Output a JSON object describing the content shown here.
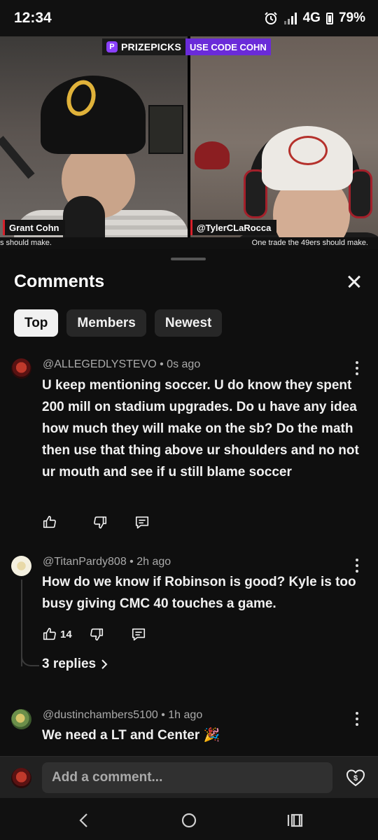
{
  "status_bar": {
    "time": "12:34",
    "network": "4G",
    "battery": "79%",
    "icons": [
      "alarm-icon",
      "signal-icon",
      "battery-icon"
    ]
  },
  "video": {
    "promo_brand": "PRIZEPICKS",
    "promo_code": "USE CODE COHN",
    "left_name": "Grant Cohn",
    "right_name": "@TylerCLaRocca",
    "ticker_left": "s should make.",
    "ticker_right": "One trade the 49ers should make."
  },
  "comments_sheet": {
    "title": "Comments",
    "filters": [
      "Top",
      "Members",
      "Newest"
    ],
    "active_filter": "Top"
  },
  "comments": [
    {
      "author": "@ALLEGEDLYSTEVO",
      "time": "0s ago",
      "text": "U keep mentioning soccer. U do know they spent 200 mill on stadium upgrades. Do u have any idea how much they will make on the sb? Do the math then use that thing above ur shoulders and no not ur mouth and see if u still blame soccer",
      "likes": ""
    },
    {
      "author": "@TitanPardy808",
      "time": "2h ago",
      "text": "How do we know if Robinson is good? Kyle is too busy giving CMC 40 touches a game.",
      "likes": "14",
      "replies": "3 replies"
    },
    {
      "author": "@dustinchambers5100",
      "time": "1h ago",
      "text": "We need a LT and Center 🎉",
      "likes": ""
    }
  ],
  "composer": {
    "placeholder": "Add a comment..."
  },
  "colors": {
    "background": "#0f0f0f",
    "chip_active": "#f1f1f1",
    "chip": "#272727",
    "promo_purple": "#6a2bd9"
  }
}
